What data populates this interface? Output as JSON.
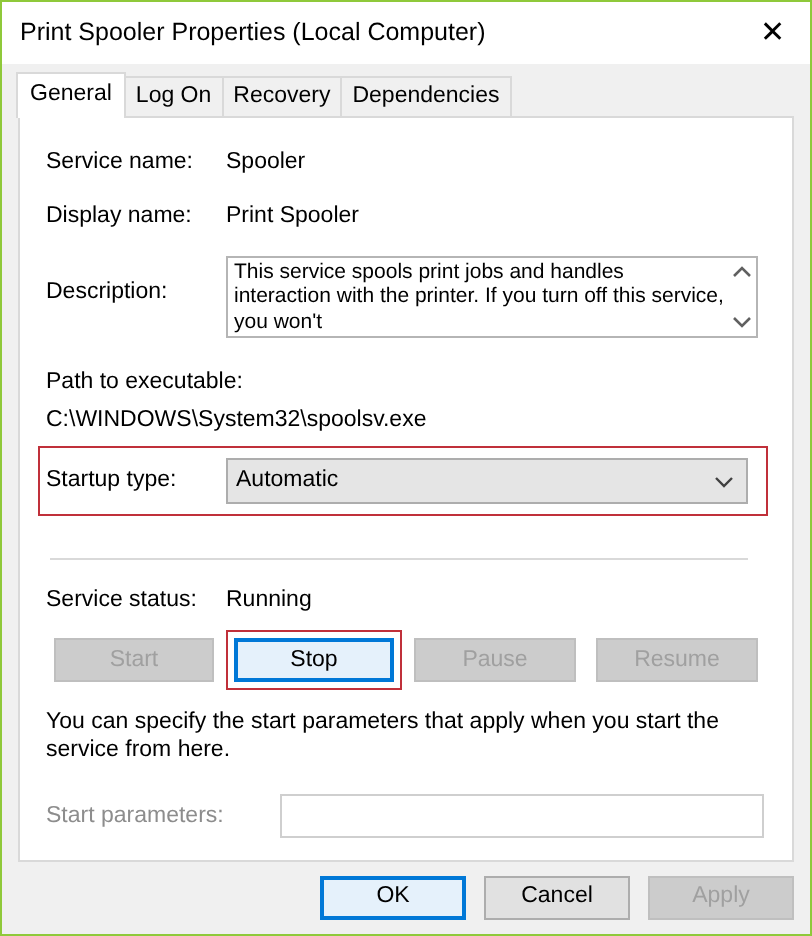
{
  "window": {
    "title": "Print Spooler Properties (Local Computer)",
    "close": "✕"
  },
  "tabs": [
    {
      "label": "General",
      "selected": true
    },
    {
      "label": "Log On",
      "selected": false
    },
    {
      "label": "Recovery",
      "selected": false
    },
    {
      "label": "Dependencies",
      "selected": false
    }
  ],
  "fields": [
    {
      "label": "Service name:",
      "value": "Spooler"
    },
    {
      "label": "Display name:",
      "value": "Print Spooler"
    }
  ],
  "description": {
    "label": "Description:",
    "value": "This service spools print jobs and handles interaction with the printer.  If you turn off this service, you won't"
  },
  "path": {
    "label": "Path to executable:",
    "value": "C:\\WINDOWS\\System32\\spoolsv.exe"
  },
  "startup_type": {
    "label": "Startup type:",
    "value": "Automatic",
    "highlighted": true
  },
  "service_status": {
    "label": "Service status:",
    "value": "Running"
  },
  "service_buttons": [
    {
      "label": "Start",
      "disabled": true,
      "highlighted": false
    },
    {
      "label": "Stop",
      "disabled": false,
      "highlighted": true
    },
    {
      "label": "Pause",
      "disabled": true,
      "highlighted": false
    },
    {
      "label": "Resume",
      "disabled": true,
      "highlighted": false
    }
  ],
  "note": "You can specify the start parameters that apply when you start the service from here.",
  "start_parameters": {
    "label": "Start parameters:",
    "disabled": true
  },
  "dialog_buttons": [
    {
      "label": "OK",
      "default": true,
      "disabled": false
    },
    {
      "label": "Cancel",
      "default": false,
      "disabled": false
    },
    {
      "label": "Apply",
      "default": false,
      "disabled": true
    }
  ]
}
